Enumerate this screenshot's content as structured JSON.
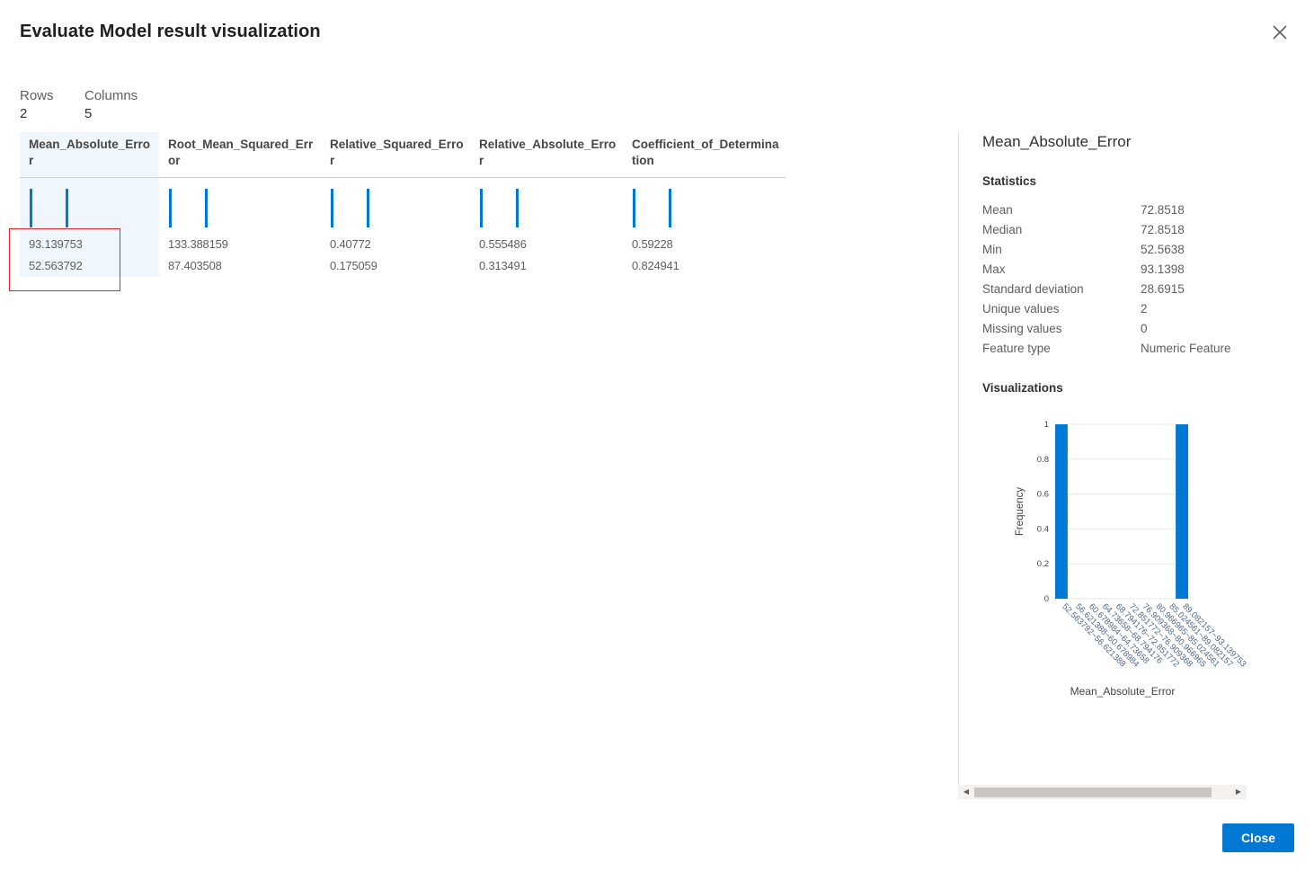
{
  "dialog": {
    "title": "Evaluate Model result visualization",
    "close_button_label": "Close"
  },
  "summary": {
    "rows_label": "Rows",
    "rows_value": "2",
    "columns_label": "Columns",
    "columns_value": "5"
  },
  "table": {
    "columns": [
      {
        "header": "Mean_Absolute_Error",
        "values": [
          "93.139753",
          "52.563792"
        ]
      },
      {
        "header": "Root_Mean_Squared_Error",
        "values": [
          "133.388159",
          "87.403508"
        ]
      },
      {
        "header": "Relative_Squared_Error",
        "values": [
          "0.40772",
          "0.175059"
        ]
      },
      {
        "header": "Relative_Absolute_Error",
        "values": [
          "0.555486",
          "0.313491"
        ]
      },
      {
        "header": "Coefficient_of_Determination",
        "values": [
          "0.59228",
          "0.824941"
        ]
      }
    ],
    "selected_column": "Mean_Absolute_Error"
  },
  "side_panel": {
    "title": "Mean_Absolute_Error",
    "statistics_heading": "Statistics",
    "statistics": [
      {
        "label": "Mean",
        "value": "72.8518"
      },
      {
        "label": "Median",
        "value": "72.8518"
      },
      {
        "label": "Min",
        "value": "52.5638"
      },
      {
        "label": "Max",
        "value": "93.1398"
      },
      {
        "label": "Standard deviation",
        "value": "28.6915"
      },
      {
        "label": "Unique values",
        "value": "2"
      },
      {
        "label": "Missing values",
        "value": "0"
      },
      {
        "label": "Feature type",
        "value": "Numeric Feature"
      }
    ],
    "visualizations_heading": "Visualizations"
  },
  "chart_data": {
    "type": "bar",
    "categories": [
      "52.563792~56.621388",
      "56.621388~60.678984",
      "60.678984~64.73658",
      "64.73658~68.794176",
      "68.794176~72.851772",
      "72.851772~76.909368",
      "76.909368~80.966965",
      "80.966965~85.024561",
      "85.024561~89.082157",
      "89.082157~93.139753"
    ],
    "values": [
      1,
      0,
      0,
      0,
      0,
      0,
      0,
      0,
      0,
      1
    ],
    "xlabel": "Mean_Absolute_Error",
    "ylabel": "Frequency",
    "ylim": [
      0,
      1
    ],
    "yticks": [
      "0",
      "0.2",
      "0.4",
      "0.6",
      "0.8",
      "1"
    ],
    "bar_color": "#0078d4",
    "grid": true
  },
  "colors": {
    "accent": "#0078d4",
    "highlight_border": "#e3262a",
    "selected_column_bg": "#eff6fc"
  }
}
